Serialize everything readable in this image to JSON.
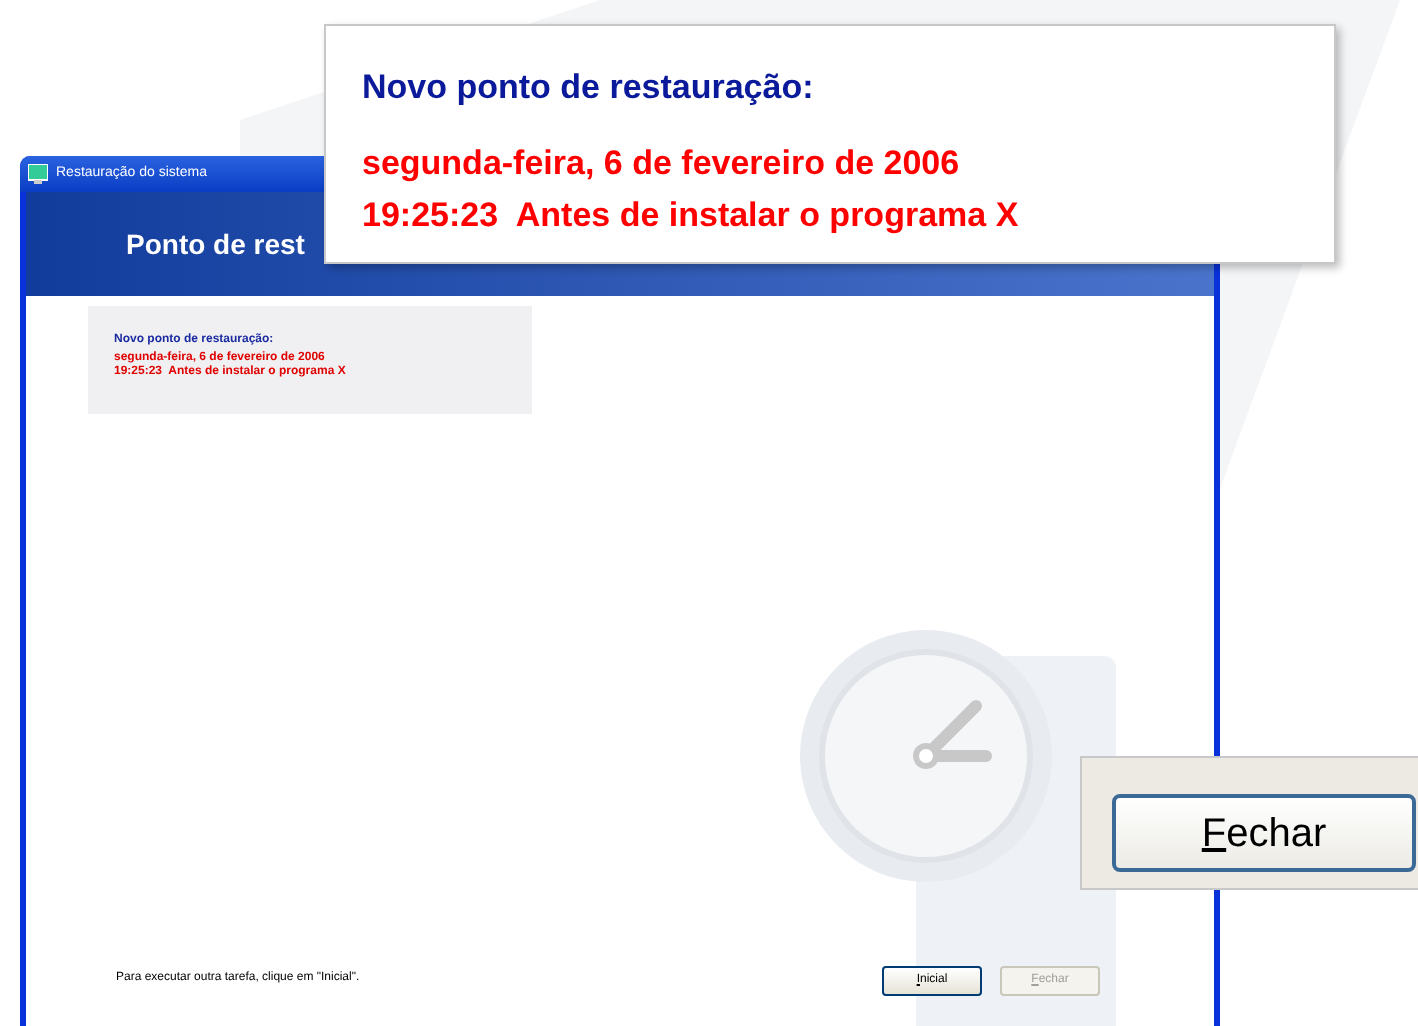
{
  "window": {
    "title": "Restauração do sistema",
    "header": "Ponto de rest"
  },
  "summary": {
    "heading": "Novo ponto de restauração:",
    "lines": [
      "segunda-feira, 6 de fevereiro de 2006",
      "19:25:23  Antes de instalar o programa X"
    ]
  },
  "footer_text": "Para executar outra tarefa, clique em \"Inicial\".",
  "buttons": [
    {
      "label": "Inicial",
      "disabled": false
    },
    {
      "label": "Fechar",
      "disabled": true
    }
  ],
  "zoom_callouts": [
    {
      "kind": "text",
      "heading": "Novo ponto de restauração:",
      "lines": [
        "segunda-feira, 6 de fevereiro de 2006",
        "19:25:23  Antes de instalar o programa X"
      ]
    },
    {
      "kind": "button",
      "label": "Fechar",
      "disabled": false
    }
  ]
}
